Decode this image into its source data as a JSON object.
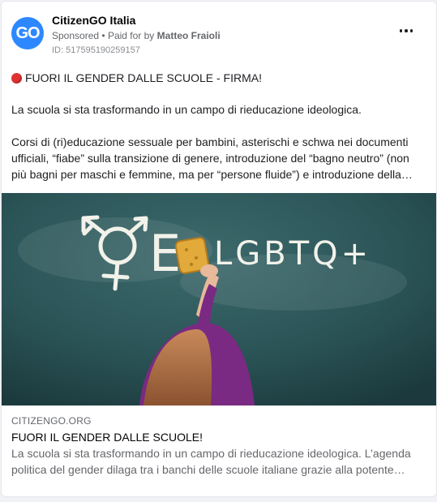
{
  "post": {
    "page_name": "CitizenGO Italia",
    "avatar_text": "GO",
    "sponsored": "Sponsored",
    "separator": "•",
    "paid_for_prefix": "Paid for by",
    "paid_for_name": "Matteo Fraioli",
    "ad_id": "ID: 517595190259157",
    "headline": "FUORI IL GENDER DALLE SCUOLE - FIRMA!",
    "paragraph_1": "La scuola si sta trasformando in un campo di rieducazione ideologica.",
    "paragraph_2": "Corsi di (ri)educazione sessuale per bambini, asterischi e schwa nei documenti ufficiali, “fiabe” sulla transizione di genere, introduzione del “bagno neutro” (non più bagni per maschi e femmine, ma per “persone fluide”) e introduzione della…"
  },
  "image": {
    "chalk_text": "LGBTQ+",
    "chalk_letter": "E"
  },
  "link_preview": {
    "domain": "CITIZENGO.ORG",
    "title": "FUORI IL GENDER DALLE SCUOLE!",
    "description": "La scuola si sta trasformando in un campo di rieducazione ideologica. L’agenda politica del gender dilaga tra i banchi delle scuole italiane grazie alla potente…"
  },
  "colors": {
    "avatar": "#2d88ff",
    "red_dot": "#e03131",
    "chalkboard": "#2c5558"
  },
  "icons": [
    "more-options-icon",
    "red-circle-icon"
  ]
}
